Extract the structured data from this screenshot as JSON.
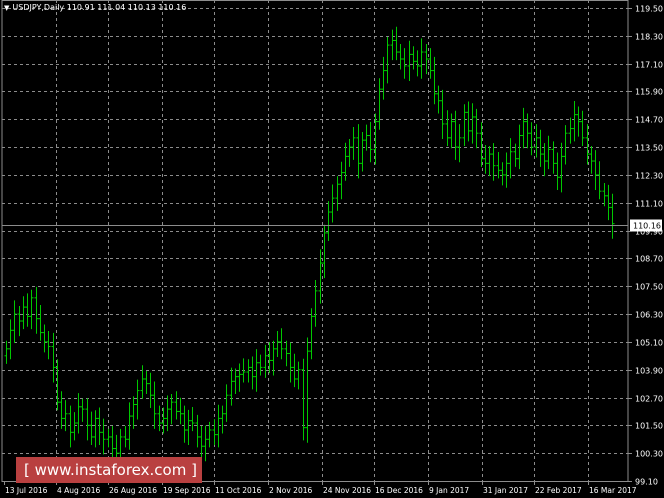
{
  "header": {
    "symbol": "USDJPY,Daily",
    "ohlc": "110.91 111.04 110.13 110.16"
  },
  "watermark": "[ www.instaforex.com ]",
  "colors": {
    "background": "#000000",
    "grid": "#8c8c8c",
    "candle": "#00c800",
    "axis_text": "#ffffff",
    "price_line": "#8c8c8c",
    "watermark_bg": "#b94040"
  },
  "chart_data": {
    "type": "bar",
    "title": "USDJPY,Daily",
    "current_price": 110.16,
    "current_price_label": "110.16",
    "ylim": [
      99.1,
      119.9
    ],
    "y_ticks": [
      {
        "value": 119.5,
        "label": "119.50"
      },
      {
        "value": 118.3,
        "label": "118.30"
      },
      {
        "value": 117.1,
        "label": "117.10"
      },
      {
        "value": 115.9,
        "label": "115.90"
      },
      {
        "value": 114.7,
        "label": "114.70"
      },
      {
        "value": 113.5,
        "label": "113.50"
      },
      {
        "value": 112.3,
        "label": "112.30"
      },
      {
        "value": 111.1,
        "label": "111.10"
      },
      {
        "value": 109.9,
        "label": "109.90"
      },
      {
        "value": 108.7,
        "label": "108.70"
      },
      {
        "value": 107.5,
        "label": "107.50"
      },
      {
        "value": 106.3,
        "label": "106.30"
      },
      {
        "value": 105.1,
        "label": "105.10"
      },
      {
        "value": 103.9,
        "label": "103.90"
      },
      {
        "value": 102.7,
        "label": "102.70"
      },
      {
        "value": 101.5,
        "label": "101.50"
      },
      {
        "value": 100.3,
        "label": "100.30"
      },
      {
        "value": 99.1,
        "label": "99.10"
      }
    ],
    "x_ticks": [
      "13 Jul 2016",
      "4 Aug 2016",
      "26 Aug 2016",
      "19 Sep 2016",
      "11 Oct 2016",
      "2 Nov 2016",
      "24 Nov 2016",
      "16 Dec 2016",
      "9 Jan 2017",
      "31 Jan 2017",
      "22 Feb 2017",
      "16 Mar 2017"
    ],
    "series": [
      {
        "values": [
          104.8,
          105.6,
          106.3,
          106.0,
          106.6,
          106.2,
          107.0,
          106.1,
          105.5,
          105.1,
          104.9,
          104.0,
          102.5,
          101.8,
          102.0,
          101.2,
          101.6,
          102.3,
          102.2,
          101.5,
          101.0,
          101.8,
          101.2,
          100.9,
          101.0,
          100.5,
          100.3,
          101.0,
          100.9,
          101.9,
          102.4,
          103.0,
          103.5,
          103.3,
          102.8,
          102.0,
          101.6,
          101.8,
          102.2,
          102.5,
          102.1,
          102.0,
          101.3,
          101.7,
          101.6,
          101.0,
          100.6,
          100.9,
          101.3,
          101.1,
          101.8,
          102.0,
          102.8,
          103.4,
          103.6,
          103.7,
          103.8,
          104.0,
          103.6,
          104.2,
          104.0,
          104.5,
          104.3,
          104.8,
          105.1,
          104.8,
          104.6,
          104.0,
          103.5,
          103.9,
          101.4,
          104.7,
          106.2,
          107.3,
          108.5,
          109.8,
          110.7,
          111.3,
          111.9,
          112.4,
          113.1,
          113.5,
          113.9,
          112.8,
          113.8,
          114.0,
          113.4,
          114.6,
          116.0,
          116.8,
          117.9,
          118.1,
          117.6,
          117.3,
          117.0,
          117.5,
          117.2,
          117.0,
          117.6,
          117.3,
          116.8,
          115.8,
          115.5,
          114.5,
          113.9,
          114.6,
          113.5,
          113.9,
          115.0,
          114.2,
          114.8,
          114.1,
          113.0,
          112.8,
          113.2,
          112.7,
          112.5,
          112.3,
          112.8,
          113.3,
          113.0,
          114.0,
          114.6,
          114.1,
          113.5,
          113.9,
          113.2,
          112.9,
          113.4,
          112.8,
          112.2,
          113.1,
          114.1,
          114.3,
          114.9,
          114.6,
          113.9,
          113.2,
          112.9,
          112.3,
          111.6,
          111.4,
          110.9,
          110.2
        ]
      }
    ]
  }
}
